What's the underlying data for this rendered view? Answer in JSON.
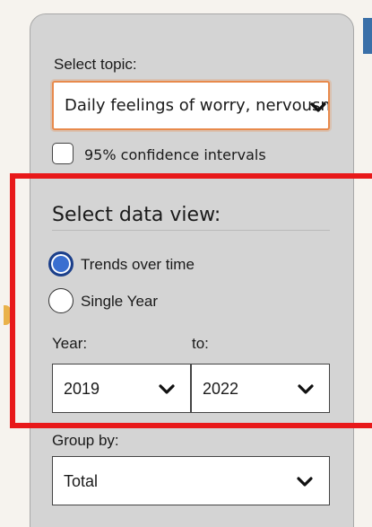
{
  "topic": {
    "label": "Select topic:",
    "selected": "Daily feelings of worry, nervousne"
  },
  "confidence": {
    "label": "95% confidence intervals",
    "checked": false
  },
  "data_view": {
    "title": "Select data view:",
    "options": [
      {
        "label": "Trends over time",
        "checked": true
      },
      {
        "label": "Single Year",
        "checked": false
      }
    ]
  },
  "year": {
    "from_label": "Year:",
    "to_label": "to:",
    "from_value": "2019",
    "to_value": "2022"
  },
  "group_by": {
    "label": "Group by:",
    "selected": "Total"
  },
  "colors": {
    "panel": "#d4d4d4",
    "focus_border": "#e88a4c",
    "radio_checked": "#3a6fd0",
    "highlight": "#e8191a"
  }
}
